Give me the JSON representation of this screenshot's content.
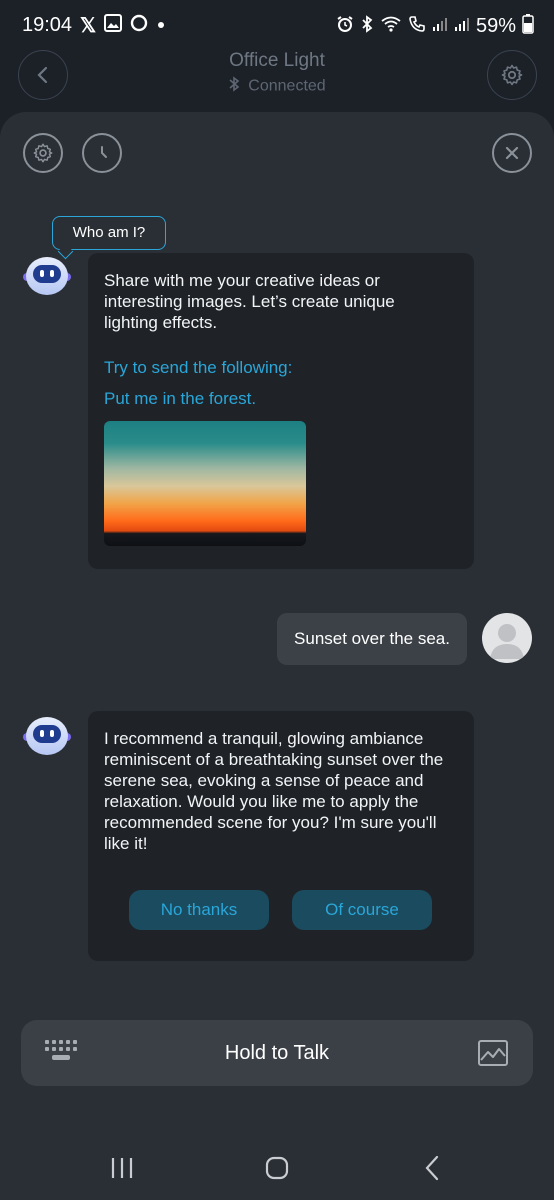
{
  "status_bar": {
    "time": "19:04",
    "battery": "59%",
    "left_icons": [
      "x-logo-icon",
      "gallery-icon",
      "circle-app-icon",
      "dot-icon"
    ],
    "right_icons": [
      "alarm-icon",
      "bluetooth-icon",
      "wifi-calling-icon",
      "call-icon",
      "signal-icon",
      "signal-icon",
      "battery-icon"
    ]
  },
  "header": {
    "title": "Office Light",
    "status": "Connected"
  },
  "tooltip": "Who am I?",
  "bot_message_1": {
    "intro": "Share with me your creative ideas or interesting images. Let’s create unique lighting effects.",
    "try_label": "Try to send the following:",
    "suggestion": "Put me in the forest."
  },
  "user_message": "Sunset over the sea.",
  "bot_message_2": {
    "text": "I recommend a tranquil, glowing ambiance reminiscent of a breathtaking sunset over the serene sea, evoking a sense of peace and relaxation. Would you like me to apply the recommended scene for you? I'm sure you'll like it!",
    "decline_label": "No thanks",
    "accept_label": "Of course"
  },
  "input_bar": {
    "hold_label": "Hold to Talk"
  },
  "colors": {
    "accent": "#2aa6d8",
    "sheet_bg": "#2a2f35",
    "bubble_bg": "#1f2328",
    "button_bg": "#1b4b5f"
  }
}
